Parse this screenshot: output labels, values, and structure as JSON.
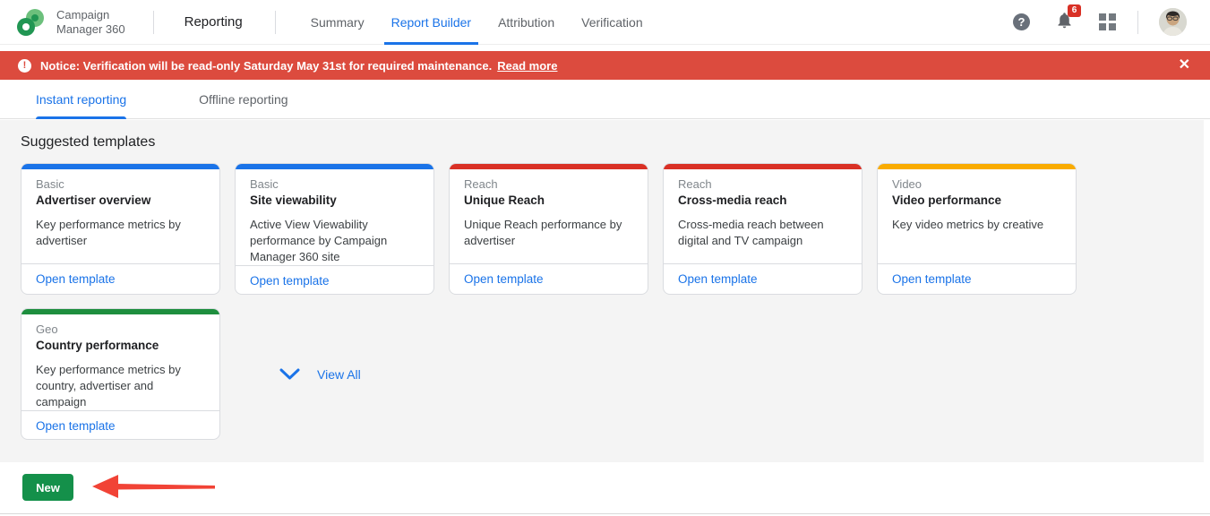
{
  "header": {
    "product_name_line1": "Campaign",
    "product_name_line2": "Manager 360",
    "section_label": "Reporting",
    "tabs": [
      {
        "label": "Summary",
        "active": false
      },
      {
        "label": "Report Builder",
        "active": true
      },
      {
        "label": "Attribution",
        "active": false
      },
      {
        "label": "Verification",
        "active": false
      }
    ],
    "help_glyph": "?",
    "notification_count": "6"
  },
  "notice_banner": {
    "icon_glyph": "!",
    "text": "Notice: Verification will be read-only Saturday May 31st for required maintenance.",
    "link_label": "Read more",
    "close_glyph": "✕",
    "background_color": "#dc4b3e"
  },
  "sub_tabs": [
    {
      "label": "Instant reporting",
      "active": true
    },
    {
      "label": "Offline reporting",
      "active": false
    }
  ],
  "section_title": "Suggested templates",
  "templates": [
    {
      "category": "Basic",
      "title": "Advertiser overview",
      "description": "Key performance metrics by advertiser",
      "action_label": "Open template",
      "accent_color": "#1a73e8"
    },
    {
      "category": "Basic",
      "title": "Site viewability",
      "description": "Active View Viewability performance by Campaign Manager 360 site",
      "action_label": "Open template",
      "accent_color": "#1a73e8"
    },
    {
      "category": "Reach",
      "title": "Unique Reach",
      "description": "Unique Reach performance by advertiser",
      "action_label": "Open template",
      "accent_color": "#d93025"
    },
    {
      "category": "Reach",
      "title": "Cross-media reach",
      "description": "Cross-media reach between digital and TV campaign",
      "action_label": "Open template",
      "accent_color": "#d93025"
    },
    {
      "category": "Video",
      "title": "Video performance",
      "description": "Key video metrics by creative",
      "action_label": "Open template",
      "accent_color": "#f9ab00"
    },
    {
      "category": "Geo",
      "title": "Country performance",
      "description": "Key performance metrics by country, advertiser and campaign",
      "action_label": "Open template",
      "accent_color": "#1e8e3e"
    }
  ],
  "view_all_label": "View All",
  "footer": {
    "new_button_label": "New"
  },
  "colors": {
    "active_blue": "#1a73e8",
    "new_button_green": "#14904a",
    "notification_red": "#d93025",
    "annotation_arrow_red": "#f14336",
    "content_background": "#f4f4f4"
  }
}
